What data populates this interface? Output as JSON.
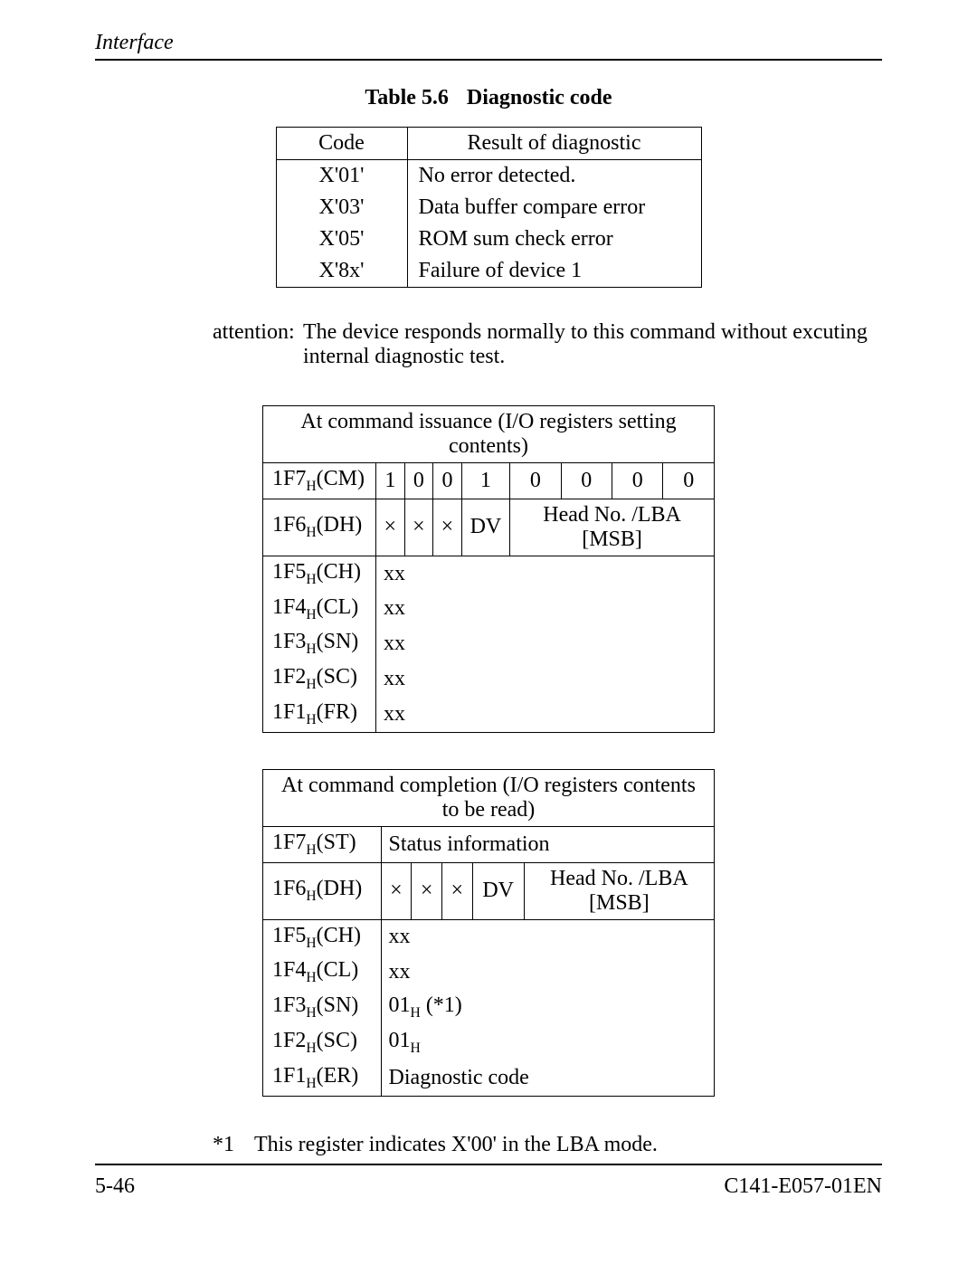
{
  "header": "Interface",
  "footer": {
    "left": "5-46",
    "right": "C141-E057-01EN"
  },
  "table56": {
    "caption_num": "Table 5.6",
    "caption_title": "Diagnostic code",
    "head": {
      "code": "Code",
      "result": "Result of diagnostic"
    },
    "rows": [
      {
        "code": "X'01'",
        "result": "No error detected."
      },
      {
        "code": "X'03'",
        "result": "Data buffer compare error"
      },
      {
        "code": "X'05'",
        "result": "ROM sum check error"
      },
      {
        "code": "X'8x'",
        "result": "Failure of device 1"
      }
    ]
  },
  "attention": {
    "label": "attention:",
    "text": "The device responds normally to this command without excuting internal diagnostic test."
  },
  "issuance": {
    "title": "At command issuance (I/O registers setting contents)",
    "rows": {
      "cm": {
        "reg_prefix": "1F7",
        "reg_suffix": "(CM)",
        "bits": [
          "1",
          "0",
          "0",
          "1",
          "0",
          "0",
          "0",
          "0"
        ]
      },
      "dh": {
        "reg_prefix": "1F6",
        "reg_suffix": "(DH)",
        "b7": "×",
        "b6": "×",
        "b5": "×",
        "b4": "DV",
        "head": "Head No. /LBA [MSB]"
      },
      "ch": {
        "reg_prefix": "1F5",
        "reg_suffix": "(CH)",
        "val": "xx"
      },
      "cl": {
        "reg_prefix": "1F4",
        "reg_suffix": "(CL)",
        "val": "xx"
      },
      "sn": {
        "reg_prefix": "1F3",
        "reg_suffix": "(SN)",
        "val": "xx"
      },
      "sc": {
        "reg_prefix": "1F2",
        "reg_suffix": "(SC)",
        "val": "xx"
      },
      "fr": {
        "reg_prefix": "1F1",
        "reg_suffix": "(FR)",
        "val": "xx"
      }
    }
  },
  "completion": {
    "title": "At command completion (I/O registers contents to be read)",
    "rows": {
      "st": {
        "reg_prefix": "1F7",
        "reg_suffix": "(ST)",
        "val": "Status information"
      },
      "dh": {
        "reg_prefix": "1F6",
        "reg_suffix": "(DH)",
        "b7": "×",
        "b6": "×",
        "b5": "×",
        "b4": "DV",
        "head": "Head No. /LBA [MSB]"
      },
      "ch": {
        "reg_prefix": "1F5",
        "reg_suffix": "(CH)",
        "val": "xx"
      },
      "cl": {
        "reg_prefix": "1F4",
        "reg_suffix": "(CL)",
        "val": "xx"
      },
      "sn": {
        "reg_prefix": "1F3",
        "reg_suffix": "(SN)",
        "val_prefix": "01",
        "val_suffix": " (*1)"
      },
      "sc": {
        "reg_prefix": "1F2",
        "reg_suffix": "(SC)",
        "val_prefix": "01",
        "val_suffix": ""
      },
      "er": {
        "reg_prefix": "1F1",
        "reg_suffix": "(ER)",
        "val": "Diagnostic code"
      }
    }
  },
  "footnote": {
    "label": "*1",
    "text": "This register indicates X'00' in the LBA mode."
  }
}
